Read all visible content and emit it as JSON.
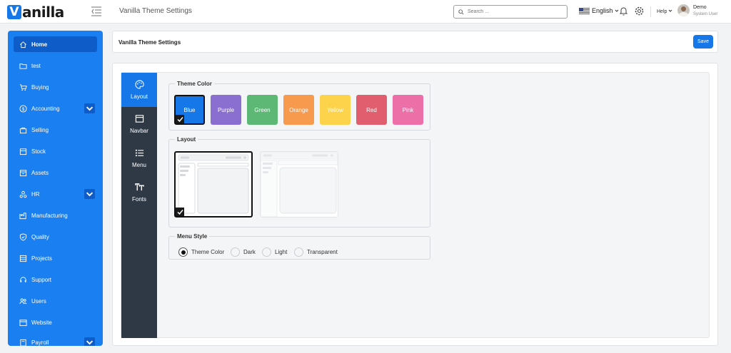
{
  "app": {
    "logo_letter": "V",
    "logo_rest": "anilla",
    "page_title": "Vanilla Theme Settings"
  },
  "topbar": {
    "search_placeholder": "Search ...",
    "language": "English",
    "help": "Help",
    "user_name": "Demo",
    "user_role": "System User"
  },
  "sidebar": {
    "items": [
      {
        "label": "Home",
        "icon": "home-icon",
        "active": true
      },
      {
        "label": "test",
        "icon": "folder-icon"
      },
      {
        "label": "Buying",
        "icon": "cart-icon"
      },
      {
        "label": "Accounting",
        "icon": "dollar-icon",
        "expandable": true
      },
      {
        "label": "Selling",
        "icon": "shop-icon"
      },
      {
        "label": "Stock",
        "icon": "box-icon"
      },
      {
        "label": "Assets",
        "icon": "assets-icon"
      },
      {
        "label": "HR",
        "icon": "hr-icon",
        "expandable": true
      },
      {
        "label": "Manufacturing",
        "icon": "factory-icon"
      },
      {
        "label": "Quality",
        "icon": "shield-check-icon"
      },
      {
        "label": "Projects",
        "icon": "projects-icon"
      },
      {
        "label": "Support",
        "icon": "support-icon"
      },
      {
        "label": "Users",
        "icon": "users-icon"
      },
      {
        "label": "Website",
        "icon": "browser-icon"
      },
      {
        "label": "Payroll",
        "icon": "payroll-icon",
        "expandable": true
      }
    ]
  },
  "header": {
    "title": "Vanilla Theme Settings",
    "save_label": "Save"
  },
  "tabs": [
    {
      "label": "Layout",
      "icon": "palette-icon",
      "active": true
    },
    {
      "label": "Navbar",
      "icon": "window-icon"
    },
    {
      "label": "Menu",
      "icon": "list-icon"
    },
    {
      "label": "Fonts",
      "icon": "text-size-icon"
    }
  ],
  "theme_color": {
    "legend": "Theme Color",
    "selected": "Blue",
    "options": [
      {
        "label": "Blue",
        "color": "#1677e8"
      },
      {
        "label": "Purple",
        "color": "#8a6fd1"
      },
      {
        "label": "Green",
        "color": "#5cb874"
      },
      {
        "label": "Orange",
        "color": "#f89a4e"
      },
      {
        "label": "Yellow",
        "color": "#fcd34a"
      },
      {
        "label": "Red",
        "color": "#e05e6d"
      },
      {
        "label": "Pink",
        "color": "#ec6fa8"
      }
    ]
  },
  "layout": {
    "legend": "Layout",
    "selected_index": 0
  },
  "menu_style": {
    "legend": "Menu Style",
    "selected": "Theme Color",
    "options": [
      "Theme Color",
      "Dark",
      "Light",
      "Transparent"
    ]
  }
}
